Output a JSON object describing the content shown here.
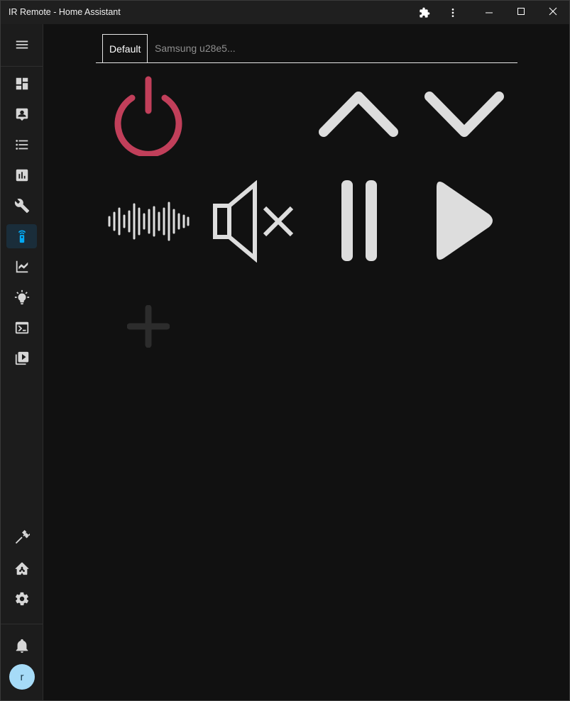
{
  "window": {
    "title": "IR Remote - Home Assistant"
  },
  "titlebar_icons": [
    "puzzle-icon",
    "more-vert-icon",
    "minimize-icon",
    "maximize-icon",
    "close-icon"
  ],
  "sidebar": {
    "items": [
      {
        "name": "overview",
        "icon": "dashboard-icon"
      },
      {
        "name": "map",
        "icon": "account-box-icon"
      },
      {
        "name": "logbook",
        "icon": "format-list-icon"
      },
      {
        "name": "history",
        "icon": "chart-box-icon"
      },
      {
        "name": "tools",
        "icon": "wrench-icon"
      },
      {
        "name": "ir-remote",
        "icon": "remote-icon",
        "active": true
      },
      {
        "name": "energy",
        "icon": "area-chart-icon"
      },
      {
        "name": "lights",
        "icon": "lightbulb-icon"
      },
      {
        "name": "terminal",
        "icon": "console-icon"
      },
      {
        "name": "media",
        "icon": "play-box-icon"
      }
    ],
    "bottom_items": [
      {
        "name": "developer-tools",
        "icon": "hammer-icon"
      },
      {
        "name": "supervisor",
        "icon": "home-assistant-icon"
      },
      {
        "name": "settings",
        "icon": "cog-icon"
      },
      {
        "name": "notifications",
        "icon": "bell-icon"
      }
    ],
    "avatar_initial": "r"
  },
  "tabs": [
    {
      "label": "Default",
      "active": true
    },
    {
      "label": "Samsung u28e5...",
      "active": false
    }
  ],
  "remote_buttons": [
    {
      "name": "power",
      "icon": "power-icon",
      "color": "#c13f5a"
    },
    {
      "name": "channel-up",
      "icon": "chevron-up-icon",
      "color": "#dddddd"
    },
    {
      "name": "channel-down",
      "icon": "chevron-down-icon",
      "color": "#dddddd"
    },
    {
      "name": "audio",
      "icon": "waveform-icon",
      "color": "#dddddd"
    },
    {
      "name": "mute",
      "icon": "volume-off-icon",
      "color": "#dddddd"
    },
    {
      "name": "pause",
      "icon": "pause-icon",
      "color": "#dddddd"
    },
    {
      "name": "play",
      "icon": "play-icon",
      "color": "#dddddd"
    },
    {
      "name": "add",
      "icon": "plus-icon",
      "color": "#2c2c2c"
    }
  ],
  "colors": {
    "accent": "#03a9f4",
    "sidebar_icon": "#d6d6d6",
    "power": "#c13f5a"
  }
}
